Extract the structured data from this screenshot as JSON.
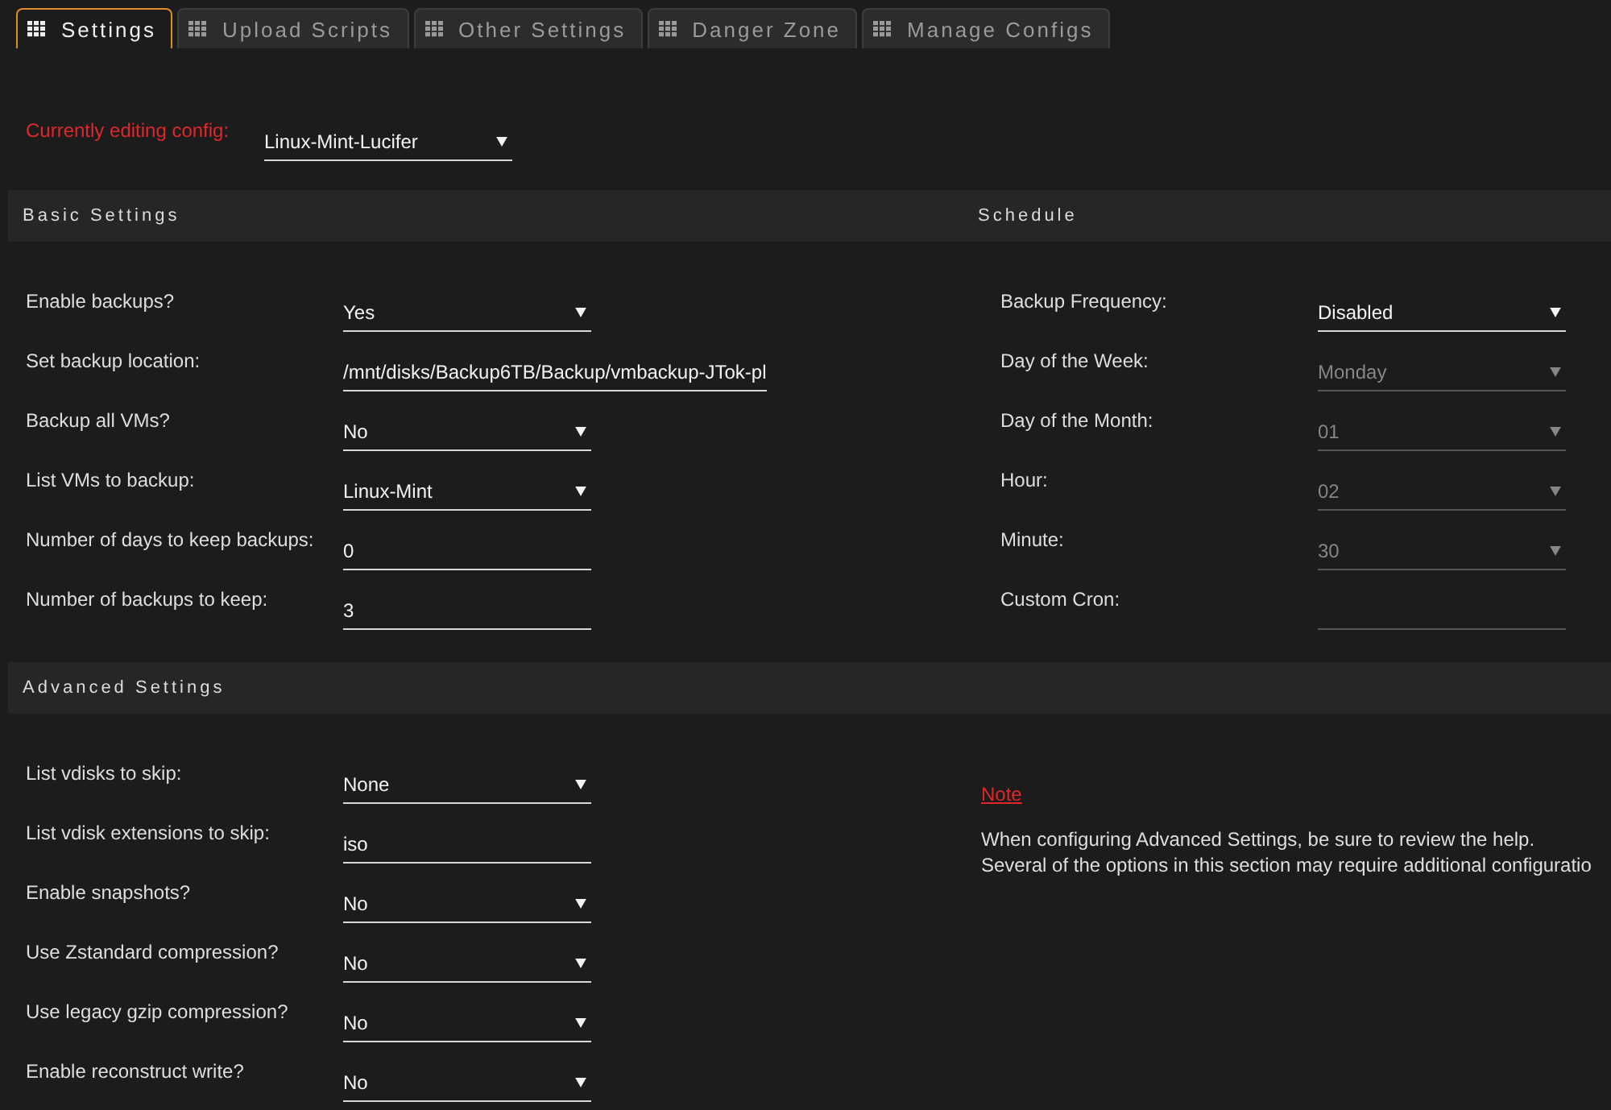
{
  "tabs": [
    {
      "label": "Settings",
      "selected": true
    },
    {
      "label": "Upload Scripts",
      "selected": false
    },
    {
      "label": "Other Settings",
      "selected": false
    },
    {
      "label": "Danger Zone",
      "selected": false
    },
    {
      "label": "Manage Configs",
      "selected": false
    }
  ],
  "config_selector": {
    "label": "Currently editing config:",
    "value": "Linux-Mint-Lucifer"
  },
  "basic_settings": {
    "title": "Basic Settings",
    "fields": [
      {
        "label": "Enable backups?",
        "kind": "select",
        "value": "Yes",
        "disabled": false
      },
      {
        "label": "Set backup location:",
        "kind": "text",
        "value": "/mnt/disks/Backup6TB/Backup/vmbackup-JTok-pl",
        "disabled": false
      },
      {
        "label": "Backup all VMs?",
        "kind": "select",
        "value": "No",
        "disabled": false
      },
      {
        "label": "List VMs to backup:",
        "kind": "select",
        "value": "Linux-Mint",
        "disabled": false
      },
      {
        "label": "Number of days to keep backups:",
        "kind": "text",
        "value": "0",
        "disabled": false
      },
      {
        "label": "Number of backups to keep:",
        "kind": "text",
        "value": "3",
        "disabled": false
      }
    ]
  },
  "schedule": {
    "title": "Schedule",
    "fields": [
      {
        "label": "Backup Frequency:",
        "kind": "select",
        "value": "Disabled",
        "disabled": false
      },
      {
        "label": "Day of the Week:",
        "kind": "select",
        "value": "Monday",
        "disabled": true
      },
      {
        "label": "Day of the Month:",
        "kind": "select",
        "value": "01",
        "disabled": true
      },
      {
        "label": "Hour:",
        "kind": "select",
        "value": "02",
        "disabled": true
      },
      {
        "label": "Minute:",
        "kind": "select",
        "value": "30",
        "disabled": true
      },
      {
        "label": "Custom Cron:",
        "kind": "text",
        "disabled": true
      }
    ]
  },
  "advanced_settings": {
    "title": "Advanced Settings",
    "fields": [
      {
        "label": "List vdisks to skip:",
        "kind": "select",
        "value": "None",
        "disabled": false
      },
      {
        "label": "List vdisk extensions to skip:",
        "kind": "text",
        "value": "iso",
        "disabled": false
      },
      {
        "label": "Enable snapshots?",
        "kind": "select",
        "value": "No",
        "disabled": false
      },
      {
        "label": "Use Zstandard compression?",
        "kind": "select",
        "value": "No",
        "disabled": false
      },
      {
        "label": "Use legacy gzip compression?",
        "kind": "select",
        "value": "No",
        "disabled": false
      },
      {
        "label": "Enable reconstruct write?",
        "kind": "select",
        "value": "No",
        "disabled": false
      }
    ],
    "note": {
      "title": "Note",
      "lines": [
        "When configuring Advanced Settings, be sure to review the help.",
        "Several of the options in this section may require additional configuratio"
      ]
    }
  }
}
